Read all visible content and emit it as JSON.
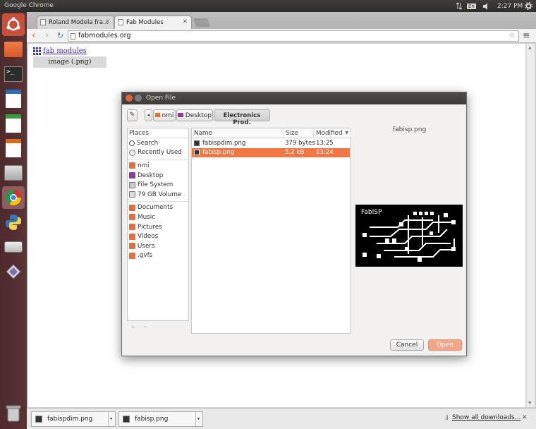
{
  "system": {
    "app_title": "Google Chrome",
    "clock": "2:27 PM",
    "kbd": "En"
  },
  "browser": {
    "tabs": [
      {
        "label": "Roland Modela fra..."
      },
      {
        "label": "Fab Modules"
      }
    ],
    "url": "fabmodules.org",
    "downloads": [
      {
        "name": "fabispdim.png"
      },
      {
        "name": "fabisp.png"
      }
    ],
    "show_all_downloads": "Show all downloads..."
  },
  "page": {
    "logo_link": "fab modules",
    "format_item": "image (.png)"
  },
  "dialog": {
    "title": "Open File",
    "crumbs": [
      "nmi",
      "Desktop",
      "Electronics Prod."
    ],
    "places_header": "Places",
    "places": [
      {
        "label": "Search",
        "icon": "search-icon"
      },
      {
        "label": "Recently Used",
        "icon": "clock-icon"
      },
      {
        "label": "nmi",
        "icon": "home-folder-icon"
      },
      {
        "label": "Desktop",
        "icon": "desktop-icon"
      },
      {
        "label": "File System",
        "icon": "drive-icon"
      },
      {
        "label": "79 GB Volume",
        "icon": "volume-icon"
      },
      {
        "label": "Documents",
        "icon": "folder-icon"
      },
      {
        "label": "Music",
        "icon": "music-folder-icon"
      },
      {
        "label": "Pictures",
        "icon": "pictures-folder-icon"
      },
      {
        "label": "Videos",
        "icon": "videos-folder-icon"
      },
      {
        "label": "Users",
        "icon": "folder-icon"
      },
      {
        "label": ".gvfs",
        "icon": "folder-icon"
      }
    ],
    "places_controls": [
      "+",
      "−"
    ],
    "columns": {
      "name": "Name",
      "size": "Size",
      "modified": "Modified"
    },
    "files": [
      {
        "name": "fabispdim.png",
        "size": "379 bytes",
        "modified": "13:25",
        "selected": false
      },
      {
        "name": "fabisp.png",
        "size": "5.2 kB",
        "modified": "13:24",
        "selected": true
      }
    ],
    "preview_label": "fabisp.png",
    "preview_text": "FabISP",
    "cancel": "Cancel",
    "open": "Open"
  },
  "colors": {
    "accent": "#f07746",
    "launcher": "#5a3436",
    "title_bar": "#3c3b37"
  }
}
